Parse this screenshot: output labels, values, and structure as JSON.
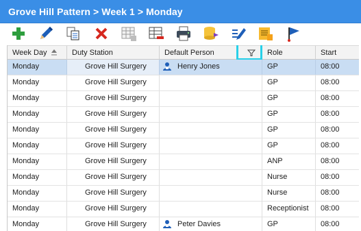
{
  "title": "Grove Hill Pattern > Week 1 > Monday",
  "toolbar": {
    "buttons": [
      {
        "name": "add-button",
        "icon": "plus-icon"
      },
      {
        "name": "edit-button",
        "icon": "pencil-icon"
      },
      {
        "name": "copy-button",
        "icon": "copy-icon"
      },
      {
        "name": "delete-button",
        "icon": "cross-icon"
      },
      {
        "name": "add-column-button",
        "icon": "grid-add-icon"
      },
      {
        "name": "remove-row-button",
        "icon": "grid-remove-icon"
      },
      {
        "name": "print-button",
        "icon": "printer-icon"
      },
      {
        "name": "database-button",
        "icon": "database-icon"
      },
      {
        "name": "edit-list-button",
        "icon": "pencil-list-icon"
      },
      {
        "name": "notes-button",
        "icon": "notes-icon"
      },
      {
        "name": "flag-button",
        "icon": "flag-icon"
      }
    ]
  },
  "grid": {
    "columns": {
      "week_day": "Week Day",
      "duty_station": "Duty Station",
      "default_person": "Default Person",
      "role": "Role",
      "start": "Start"
    },
    "rows": [
      {
        "week_day": "Monday",
        "duty_station": "Grove Hill Surgery",
        "default_person": "Henry Jones",
        "role": "GP",
        "start": "08:00",
        "selected": true
      },
      {
        "week_day": "Monday",
        "duty_station": "Grove Hill Surgery",
        "default_person": "",
        "role": "GP",
        "start": "08:00"
      },
      {
        "week_day": "Monday",
        "duty_station": "Grove Hill Surgery",
        "default_person": "",
        "role": "GP",
        "start": "08:00"
      },
      {
        "week_day": "Monday",
        "duty_station": "Grove Hill Surgery",
        "default_person": "",
        "role": "GP",
        "start": "08:00"
      },
      {
        "week_day": "Monday",
        "duty_station": "Grove Hill Surgery",
        "default_person": "",
        "role": "GP",
        "start": "08:00"
      },
      {
        "week_day": "Monday",
        "duty_station": "Grove Hill Surgery",
        "default_person": "",
        "role": "GP",
        "start": "08:00"
      },
      {
        "week_day": "Monday",
        "duty_station": "Grove Hill Surgery",
        "default_person": "",
        "role": "ANP",
        "start": "08:00"
      },
      {
        "week_day": "Monday",
        "duty_station": "Grove Hill Surgery",
        "default_person": "",
        "role": "Nurse",
        "start": "08:00"
      },
      {
        "week_day": "Monday",
        "duty_station": "Grove Hill Surgery",
        "default_person": "",
        "role": "Nurse",
        "start": "08:00"
      },
      {
        "week_day": "Monday",
        "duty_station": "Grove Hill Surgery",
        "default_person": "",
        "role": "Receptionist",
        "start": "08:00"
      },
      {
        "week_day": "Monday",
        "duty_station": "Grove Hill Surgery",
        "default_person": "Peter Davies",
        "role": "GP",
        "start": "08:00"
      }
    ]
  },
  "colors": {
    "title_bar": "#3a8ee6",
    "selection": "#c9ddf3",
    "filter_highlight": "#29d0e8"
  }
}
